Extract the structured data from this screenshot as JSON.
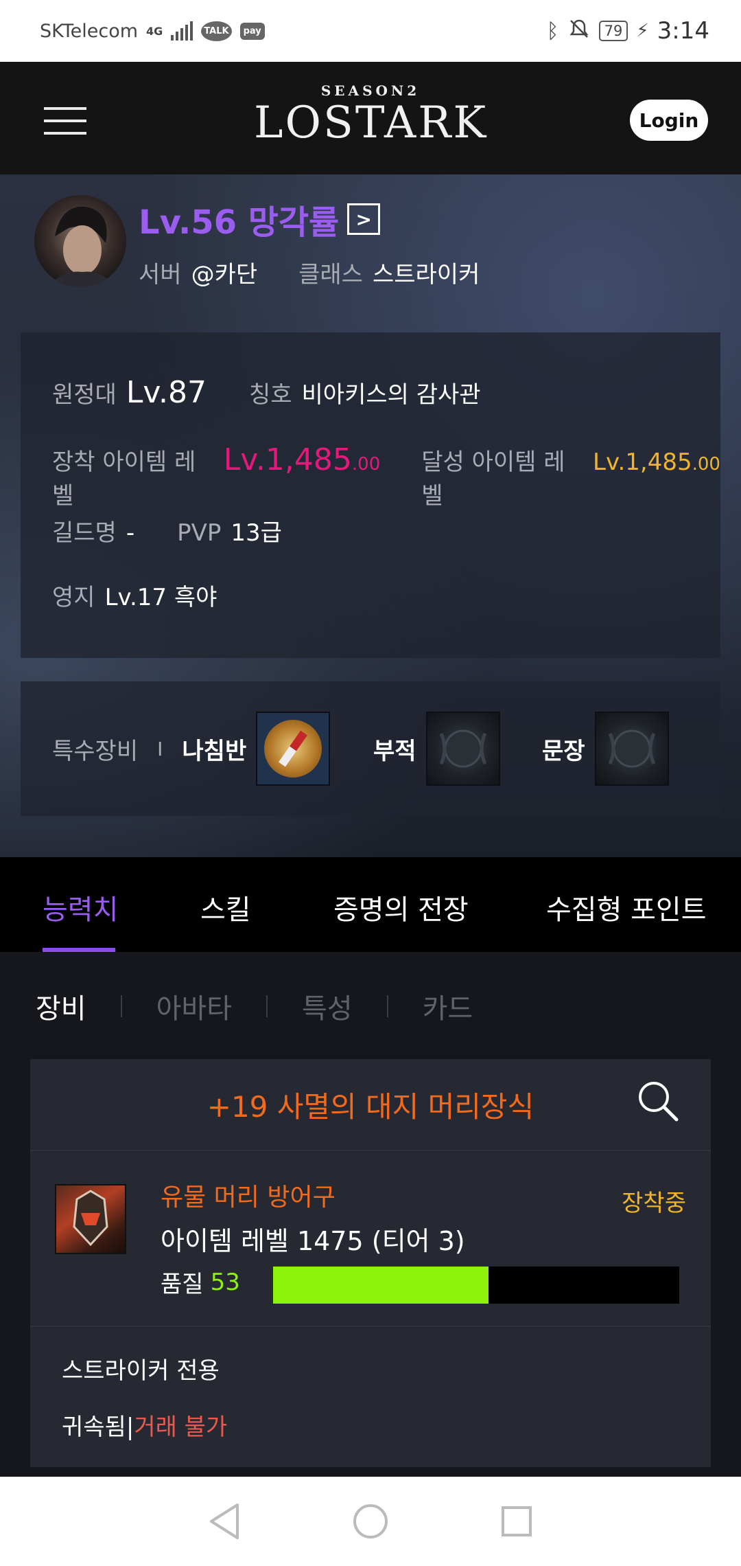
{
  "status_bar": {
    "carrier": "SKTelecom",
    "network": "4G",
    "talk_badge": "TALK",
    "pay_badge": "pay",
    "battery": "79",
    "time": "3:14"
  },
  "header": {
    "logo_season": "SEASON2",
    "logo_title": "LOSTARK",
    "login_label": "Login"
  },
  "profile": {
    "name": "Lv.56 망각률",
    "server_label": "서버",
    "server_value": "@카단",
    "class_label": "클래스",
    "class_value": "스트라이커"
  },
  "info": {
    "expedition_label": "원정대",
    "expedition_value": "Lv.87",
    "title_label": "칭호",
    "title_value": "비아키스의 감사관",
    "equip_level_label": "장착 아이템 레벨",
    "equip_level_value": "Lv.1,485",
    "equip_level_decimal": ".00",
    "achieved_level_label": "달성 아이템 레벨",
    "achieved_level_value": "Lv.1,485",
    "achieved_level_decimal": ".00",
    "guild_label": "길드명",
    "guild_value": "-",
    "pvp_label": "PVP",
    "pvp_value": "13급",
    "estate_label": "영지",
    "estate_value": "Lv.17 흑야"
  },
  "special_equipment": {
    "label": "특수장비",
    "separator": "I",
    "compass": "나침반",
    "amulet": "부적",
    "emblem": "문장"
  },
  "main_tabs": [
    "능력치",
    "스킬",
    "증명의 전장",
    "수집형 포인트"
  ],
  "sub_tabs": [
    "장비",
    "아바타",
    "특성",
    "카드"
  ],
  "item": {
    "title": "+19 사멸의 대지 머리장식",
    "grade": "유물 머리 방어구",
    "equipped": "장착중",
    "level": "아이템 레벨 1475 (티어 3)",
    "quality_label": "품질",
    "quality_value": "53",
    "quality_fraction": 0.53,
    "class_only": "스트라이커 전용",
    "bound": "귀속됨",
    "bound_separator": "|",
    "trade": "거래 불가"
  },
  "colors": {
    "accent_purple": "#9a5df0",
    "item_orange": "#f26a1b",
    "level_pink": "#e6187c",
    "gold": "#f0b528",
    "quality_green": "#8ff20a",
    "trade_red": "#e85a4f"
  },
  "icons": {
    "menu": "hamburger-menu-icon",
    "search": "search-icon",
    "nav_back": "back-triangle-icon",
    "nav_home": "home-circle-icon",
    "nav_recents": "recents-square-icon"
  }
}
